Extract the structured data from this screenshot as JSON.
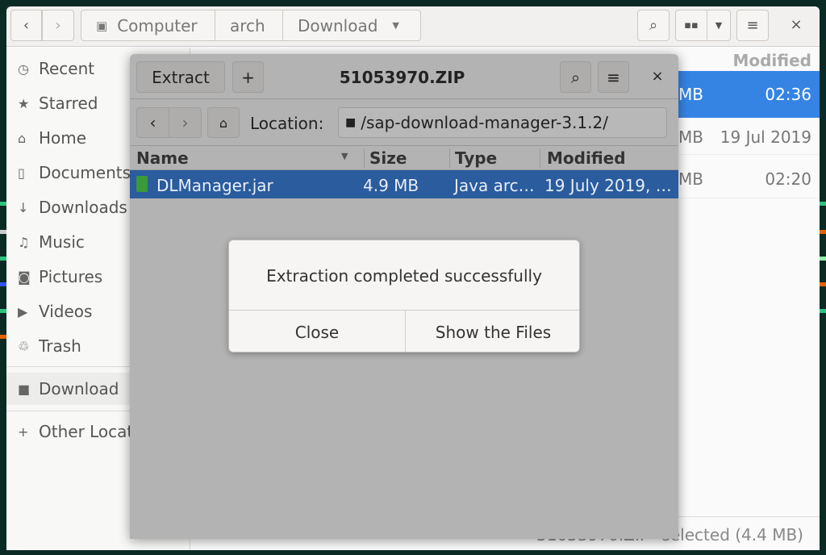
{
  "toolbar": {
    "path": [
      "Computer",
      "arch",
      "Download"
    ]
  },
  "sidebar": {
    "items": [
      {
        "label": "Recent",
        "icon": "clock-icon"
      },
      {
        "label": "Starred",
        "icon": "star-icon"
      },
      {
        "label": "Home",
        "icon": "home-icon"
      },
      {
        "label": "Documents",
        "icon": "document-icon"
      },
      {
        "label": "Downloads",
        "icon": "download-icon"
      },
      {
        "label": "Music",
        "icon": "music-icon"
      },
      {
        "label": "Pictures",
        "icon": "camera-icon"
      },
      {
        "label": "Videos",
        "icon": "video-icon"
      },
      {
        "label": "Trash",
        "icon": "trash-icon"
      },
      {
        "label": "Download",
        "icon": "folder-icon"
      },
      {
        "label": "Other Locations",
        "icon": "plus-icon"
      }
    ]
  },
  "files": {
    "modified_header": "Modified",
    "rows": [
      {
        "size": "MB",
        "modified": "02:36",
        "selected": true
      },
      {
        "size": "MB",
        "modified": "19 Jul 2019"
      },
      {
        "size": "MB",
        "modified": "02:20"
      }
    ],
    "status": "\"51053970.ZIP\" selected (4.4 MB)"
  },
  "archive": {
    "extract": "Extract",
    "add": "+",
    "title": "51053970.ZIP",
    "location_label": "Location:",
    "location": "/sap-download-manager-3.1.2/",
    "columns": [
      "Name",
      "Size",
      "Type",
      "Modified"
    ],
    "rows": [
      {
        "name": "DLManager.jar",
        "size": "4.9 MB",
        "type": "Java arc…",
        "modified": "19 July 2019, …"
      }
    ]
  },
  "dialog": {
    "message": "Extraction completed successfully",
    "close": "Close",
    "show": "Show the Files"
  },
  "colors": {
    "selection": "#3584e4",
    "archive_selection": "#2a5c9e",
    "background": "#0c2a24"
  }
}
